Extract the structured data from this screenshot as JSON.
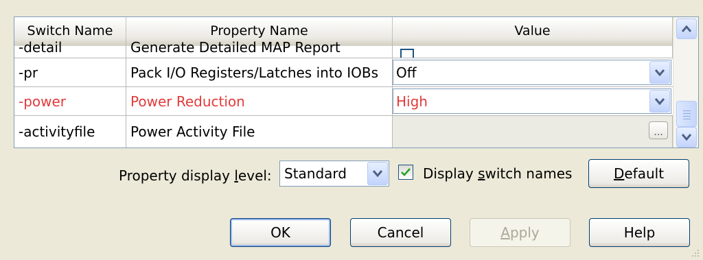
{
  "table": {
    "headers": {
      "switch": "Switch Name",
      "property": "Property Name",
      "value": "Value"
    },
    "partial_row": {
      "switch": "-detail",
      "property": "Generate Detailed MAP Report",
      "checked": false
    },
    "rows": [
      {
        "switch": "-pr",
        "property": "Pack I/O Registers/Latches into IOBs",
        "value": "Off",
        "value_type": "dropdown",
        "highlight": false
      },
      {
        "switch": "-power",
        "property": "Power Reduction",
        "value": "High",
        "value_type": "dropdown",
        "highlight": true
      },
      {
        "switch": "-activityfile",
        "property": "Power Activity File",
        "value": "",
        "value_type": "file",
        "browse_label": "..."
      }
    ],
    "highlight_color": "#e23a3a"
  },
  "options": {
    "display_level_label_pre": "Property display ",
    "display_level_label_key": "l",
    "display_level_label_post": "evel:",
    "display_level_value": "Standard",
    "switch_names_label_pre": "Display ",
    "switch_names_label_key": "s",
    "switch_names_label_post": "witch names",
    "switch_names_checked": true,
    "default_key": "D",
    "default_rest": "efault"
  },
  "footer": {
    "ok": "OK",
    "cancel": "Cancel",
    "apply_key": "A",
    "apply_rest": "pply",
    "help": "Help"
  }
}
